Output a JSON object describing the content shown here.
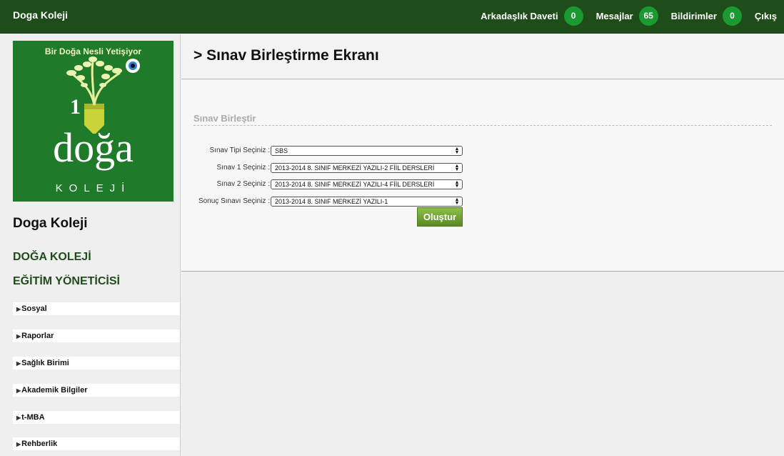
{
  "topbar": {
    "brand": "Doga Koleji",
    "friend_invite_label": "Arkadaşlık Daveti",
    "friend_invite_count": "0",
    "messages_label": "Mesajlar",
    "messages_count": "65",
    "notifications_label": "Bildirimler",
    "notifications_count": "0",
    "logout_label": "Çıkış"
  },
  "colors": {
    "topbar": "#1e4d1a",
    "badge": "#1a9a30",
    "button": "#6a9a30",
    "logo_bg": "#1f7a2a"
  },
  "logo": {
    "tagline": "Bir Doğa Nesli Yetişiyor",
    "word": "doğa",
    "sub": "KOLEJİ"
  },
  "sidebar": {
    "site_title": "Doga Koleji",
    "section1": "DOĞA KOLEJİ",
    "section2": "EĞİTİM YÖNETİCİSİ",
    "items": [
      {
        "label": "Sosyal"
      },
      {
        "label": "Raporlar"
      },
      {
        "label": "Sağlık Birimi"
      },
      {
        "label": "Akademik Bilgiler"
      },
      {
        "label": "t-MBA"
      },
      {
        "label": "Rehberlik"
      }
    ]
  },
  "main": {
    "title": "> Sınav Birleştirme Ekranı",
    "legend": "Sınav Birleştir",
    "fields": [
      {
        "label": "Sınav Tipi Seçiniz",
        "value": "SBS"
      },
      {
        "label": "Sınav 1 Seçiniz",
        "value": "2013-2014 8. SINIF MERKEZİ YAZILI-2 FİİL DERSLERİ"
      },
      {
        "label": "Sınav 2 Seçiniz",
        "value": "2013-2014 8. SINIF MERKEZİ YAZILI-4 FİİL DERSLERİ"
      },
      {
        "label": "Sonuç Sınavı Seçiniz",
        "value": "2013-2014 8. SINIF MERKEZİ YAZILI-1"
      }
    ],
    "submit_label": "Oluştur"
  }
}
